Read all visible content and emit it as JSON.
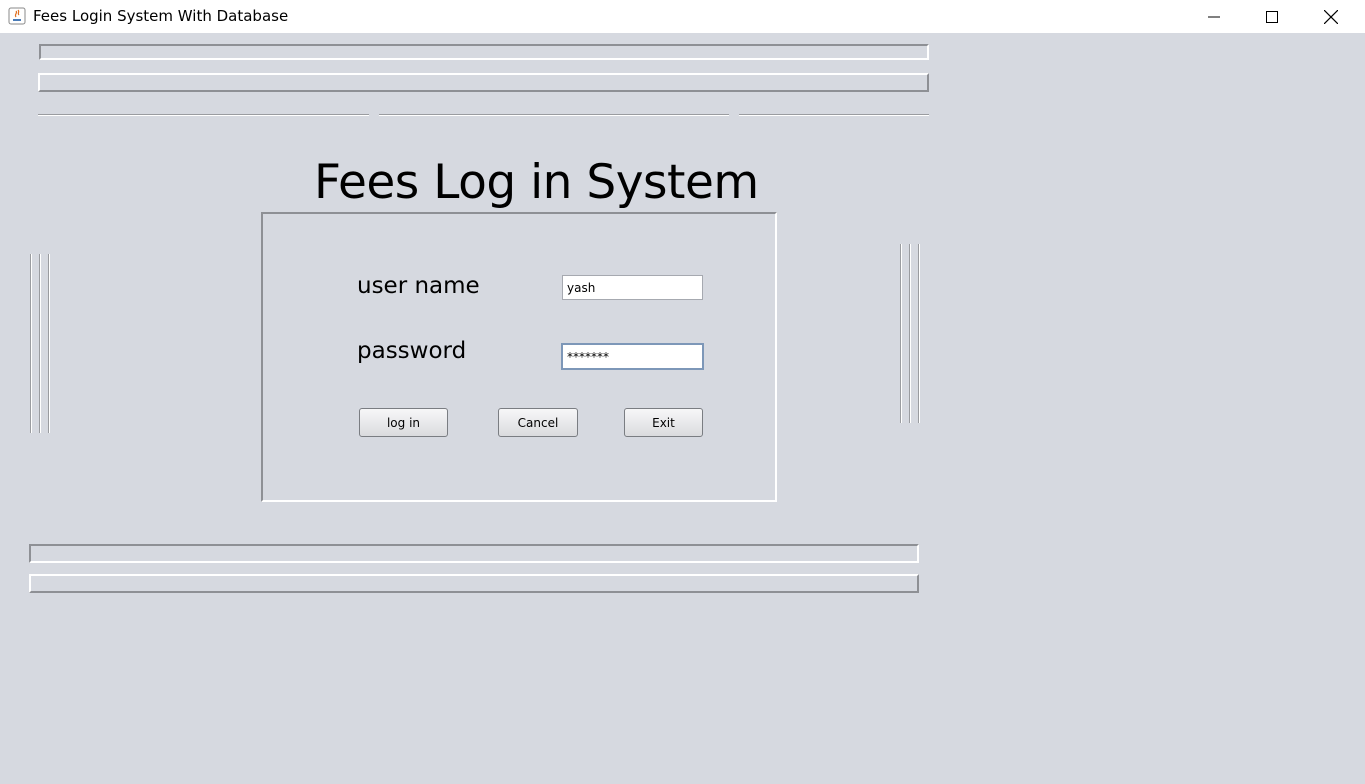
{
  "window": {
    "title": "Fees Login System With Database"
  },
  "heading": "Fees Log in System",
  "form": {
    "username_label": "user name",
    "username_value": "yash",
    "password_label": "password",
    "password_value": "*******"
  },
  "buttons": {
    "login": "log in",
    "cancel": "Cancel",
    "exit": "Exit"
  },
  "colors": {
    "background": "#d6d9e0",
    "focus_border": "#7d97b8"
  }
}
